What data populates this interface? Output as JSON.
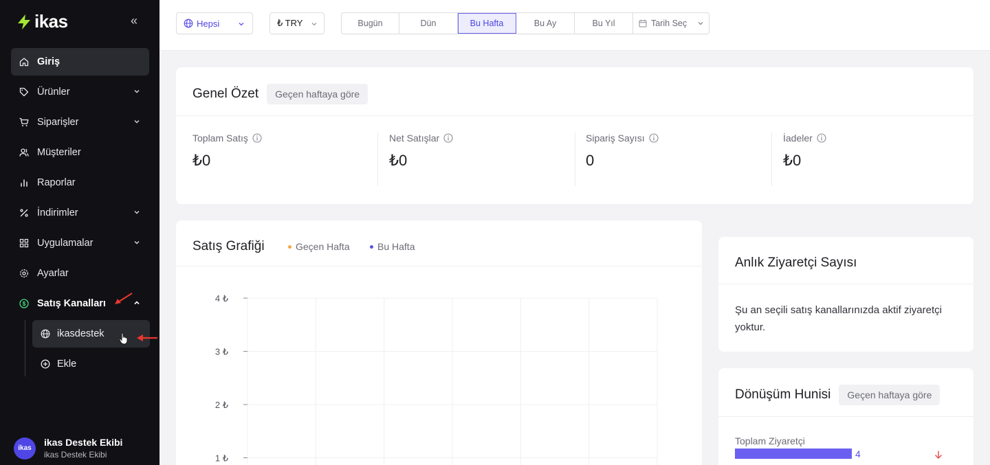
{
  "sidebar": {
    "logo": "ikas",
    "collapse_icon": "«",
    "items": [
      {
        "label": "Giriş",
        "icon": "home-icon"
      },
      {
        "label": "Ürünler",
        "icon": "tag-icon"
      },
      {
        "label": "Siparişler",
        "icon": "cart-icon"
      },
      {
        "label": "Müşteriler",
        "icon": "users-icon"
      },
      {
        "label": "Raporlar",
        "icon": "bar-chart-icon"
      },
      {
        "label": "İndirimler",
        "icon": "percent-icon"
      },
      {
        "label": "Uygulamalar",
        "icon": "grid-icon"
      },
      {
        "label": "Ayarlar",
        "icon": "gear-icon"
      },
      {
        "label": "Satış Kanalları",
        "icon": "dollar-circle-icon"
      }
    ],
    "sub_items": [
      {
        "label": "ikasdestek",
        "icon": "globe-icon"
      },
      {
        "label": "Ekle",
        "icon": "plus-circle-icon"
      }
    ],
    "user": {
      "avatar": "ikas",
      "name": "ikas Destek Ekibi",
      "subtitle": "ikas Destek Ekibi"
    }
  },
  "topbar": {
    "channel_select": "Hepsi",
    "currency_select": "₺ TRY",
    "ranges": [
      "Bugün",
      "Dün",
      "Bu Hafta",
      "Bu Ay",
      "Bu Yıl"
    ],
    "active_range": "Bu Hafta",
    "date_picker": "Tarih Seç"
  },
  "summary": {
    "title": "Genel Özet",
    "compare": "Geçen haftaya göre",
    "stats": [
      {
        "label": "Toplam Satış",
        "value": "₺0"
      },
      {
        "label": "Net Satışlar",
        "value": "₺0"
      },
      {
        "label": "Sipariş Sayısı",
        "value": "0"
      },
      {
        "label": "İadeler",
        "value": "₺0"
      }
    ]
  },
  "sales_chart": {
    "title": "Satış Grafiği",
    "legend": [
      {
        "name": "Geçen Hafta",
        "color": "#f5a742"
      },
      {
        "name": "Bu Hafta",
        "color": "#5b50e8"
      }
    ]
  },
  "chart_data": {
    "type": "line",
    "series": [
      {
        "name": "Geçen Hafta",
        "values": []
      },
      {
        "name": "Bu Hafta",
        "values": []
      }
    ],
    "y_ticks": [
      "4 ₺",
      "3 ₺",
      "2 ₺",
      "1 ₺"
    ],
    "ylim": [
      1,
      4
    ],
    "grid": true
  },
  "visitors": {
    "title": "Anlık Ziyaretçi Sayısı",
    "message": "Şu an seçili satış kanallarınızda aktif ziyaretçi yoktur."
  },
  "funnel": {
    "title": "Dönüşüm Hunisi",
    "compare": "Geçen haftaya göre",
    "rows": [
      {
        "label": "Toplam Ziyaretçi",
        "value": "4",
        "fraction": 1.0
      }
    ]
  },
  "colors": {
    "accent": "#5b50e8",
    "sidebar": "#111115",
    "orange": "#f5a742",
    "down": "#e5484d",
    "logo_bolt": "#a3e635"
  }
}
